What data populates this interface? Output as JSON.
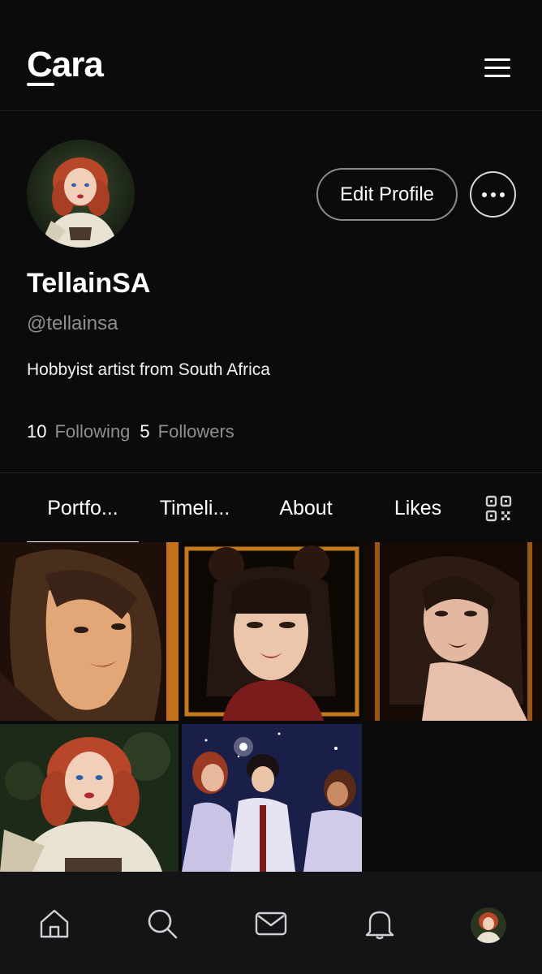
{
  "header": {
    "logo": "Cara"
  },
  "profile": {
    "display_name": "TellainSA",
    "handle": "@tellainsa",
    "bio": "Hobbyist artist from South Africa",
    "edit_label": "Edit Profile",
    "following_count": "10",
    "following_label": "Following",
    "followers_count": "5",
    "followers_label": "Followers"
  },
  "tabs": [
    {
      "label": "Portfo...",
      "active": true
    },
    {
      "label": "Timeli...",
      "active": false
    },
    {
      "label": "About",
      "active": false
    },
    {
      "label": "Likes",
      "active": false
    }
  ],
  "icons": {
    "menu": "hamburger-menu-icon",
    "more": "more-options-icon",
    "qr": "qr-code-icon",
    "nav": [
      "home-icon",
      "search-icon",
      "mail-icon",
      "bell-icon",
      "avatar"
    ]
  },
  "colors": {
    "background": "#0b0b0c",
    "nav_background": "#141416",
    "muted_text": "#8e8e93"
  }
}
